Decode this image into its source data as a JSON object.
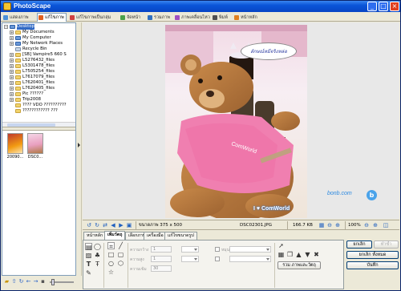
{
  "window": {
    "title": "PhotoScape"
  },
  "tabs": [
    {
      "label": "แสดงภาพ",
      "color": "#4a90d9",
      "active": false
    },
    {
      "label": "แก้ไขภาพ",
      "color": "#e06020",
      "active": true
    },
    {
      "label": "แก้ไขภาพเป็นกลุ่ม",
      "color": "#d04040",
      "active": false
    },
    {
      "label": "จัดหน้า",
      "color": "#4aa04a",
      "active": false
    },
    {
      "label": "รวมภาพ",
      "color": "#3070c0",
      "active": false
    },
    {
      "label": "ภาพเคลื่อนไหว",
      "color": "#a050c0",
      "active": false
    },
    {
      "label": "พิมพ์",
      "color": "#505050",
      "active": false
    },
    {
      "label": "หน้าหลัก",
      "color": "#e08020",
      "active": false
    }
  ],
  "tree": [
    {
      "label": "Desktop",
      "icon": "desktop-icon",
      "expander": "-",
      "selected": true
    },
    {
      "label": "My Documents",
      "icon": "folder-icon",
      "expander": "+"
    },
    {
      "label": "My Computer",
      "icon": "computer-icon",
      "expander": "+"
    },
    {
      "label": "My Network Places",
      "icon": "network-icon",
      "expander": "+"
    },
    {
      "label": "Recycle Bin",
      "icon": "recycle-bin-icon",
      "expander": ""
    },
    {
      "label": "[SB] Vampire5 660 S",
      "icon": "folder-icon",
      "expander": "+"
    },
    {
      "label": "L5276432_files",
      "icon": "folder-icon",
      "expander": "+"
    },
    {
      "label": "L5301478_files",
      "icon": "folder-icon",
      "expander": "+"
    },
    {
      "label": "L7505254_files",
      "icon": "folder-icon",
      "expander": "+"
    },
    {
      "label": "L7617079_files",
      "icon": "folder-icon",
      "expander": "+"
    },
    {
      "label": "L7620401_files",
      "icon": "folder-icon",
      "expander": "+"
    },
    {
      "label": "L7620405_files",
      "icon": "folder-icon",
      "expander": "+"
    },
    {
      "label": "Pic ??????",
      "icon": "folder-icon",
      "expander": "+"
    },
    {
      "label": "Trip2008",
      "icon": "folder-icon",
      "expander": "+"
    },
    {
      "label": "???? VDO ??????????",
      "icon": "folder-icon",
      "expander": ""
    },
    {
      "label": "???????????? ???",
      "icon": "folder-icon",
      "expander": ""
    }
  ],
  "thumbnails": [
    {
      "caption": "20090..."
    },
    {
      "caption": "DSC0..."
    }
  ],
  "viewer": {
    "size_text": "ขนาดภาพ 375 x 500",
    "filename": "DSC02301.JPG",
    "filesize": "166.7 KB",
    "zoom": "100%"
  },
  "photo": {
    "speech_text": "ลักษณ์หมีจริงหล่อ",
    "caption_text": "I ♥ ComWorld"
  },
  "watermark": {
    "text": "bonb.com",
    "badge": "b"
  },
  "edit_tabs": [
    {
      "label": "หน้าหลัก",
      "active": false
    },
    {
      "label": "เพิ่มวัตถุ",
      "active": true
    },
    {
      "label": "เลือกภาพ",
      "active": false
    },
    {
      "label": "เครื่องมือ",
      "active": false
    },
    {
      "label": "แก้ไขขนาดรูป",
      "active": false
    }
  ],
  "edit_panel": {
    "label_a": "ความกว้าง",
    "label_b": "ความสูง",
    "label_c": "ความเข้ม",
    "label_d": "หมุนภาพ",
    "field_a": "1",
    "field_b": "1",
    "field_c": "30",
    "merge_button": "รวม ภาพและวัตถุ"
  },
  "buttons": {
    "undo": "ยกเลิก",
    "redo": "ทำซ้ำ",
    "undo_all": "ยกเลิก ทั้งหมด",
    "save": "บันทึก"
  }
}
